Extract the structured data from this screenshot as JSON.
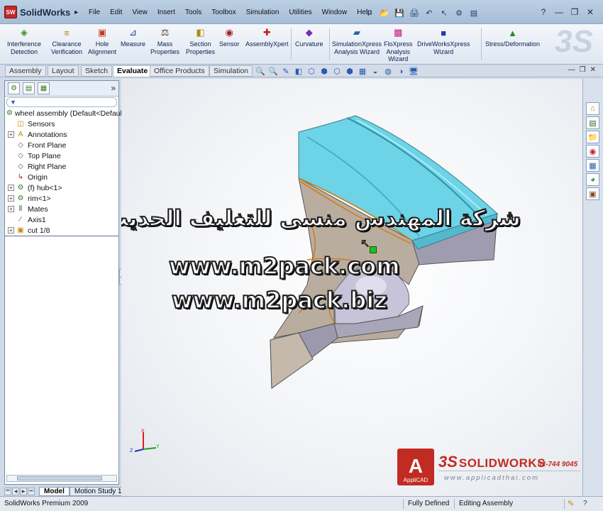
{
  "app": {
    "logo_badge": "SW",
    "logo_text": "SolidWorks",
    "logo_arrow": "►"
  },
  "menu": [
    "File",
    "Edit",
    "View",
    "Insert",
    "Tools",
    "Toolbox",
    "Simulation",
    "Utilities",
    "Window",
    "Help"
  ],
  "menu_pin": "⊳",
  "quick_access": [
    "□",
    "📂",
    "💾",
    "🖨",
    "↶",
    "↖",
    "⚙",
    "▤"
  ],
  "window_controls": {
    "help": "?",
    "minimize": "—",
    "restore": "❐",
    "close": "✕"
  },
  "command_manager": {
    "tools": [
      {
        "id": "interference-detection",
        "label1": "Interference",
        "label2": "Detection",
        "icon": "◈",
        "color": "#4a8a2a"
      },
      {
        "id": "clearance-verification",
        "label1": "Clearance",
        "label2": "Verification",
        "icon": "≡",
        "color": "#b08a10"
      },
      {
        "id": "hole-alignment",
        "label1": "Hole",
        "label2": "Alignment",
        "icon": "▣",
        "color": "#c23a20"
      },
      {
        "id": "measure",
        "label1": "Measure",
        "label2": "",
        "icon": "⊿",
        "color": "#1c4a90"
      },
      {
        "id": "mass-properties",
        "label1": "Mass",
        "label2": "Properties",
        "icon": "⚖",
        "color": "#5a3a10"
      },
      {
        "id": "section-properties",
        "label1": "Section",
        "label2": "Properties",
        "icon": "◧",
        "color": "#b08a10"
      },
      {
        "id": "sensor",
        "label1": "Sensor",
        "label2": "",
        "icon": "◉",
        "color": "#a02020"
      },
      {
        "id": "assemblyxpert",
        "label1": "AssemblyXpert",
        "label2": "",
        "icon": "✚",
        "color": "#c02020"
      },
      {
        "id": "curvature",
        "label1": "Curvature",
        "label2": "",
        "icon": "◆",
        "color": "#7a2ab0"
      },
      {
        "id": "simulationxpress",
        "label1": "SimulationXpress",
        "label2": "Analysis Wizard",
        "icon": "▰",
        "color": "#2a60b0"
      },
      {
        "id": "floxpress",
        "label1": "FloXpress",
        "label2": "Analysis",
        "label3": "Wizard",
        "icon": "▩",
        "color": "#c02080"
      },
      {
        "id": "driveworksxpress",
        "label1": "DriveWorksXpress",
        "label2": "Wizard",
        "icon": "■",
        "color": "#2a3ab0"
      },
      {
        "id": "stress-deformation",
        "label1": "Stress/Deformation",
        "label2": "",
        "icon": "▲",
        "color": "#2a8a2a"
      }
    ],
    "watermark": "3S"
  },
  "tabs": [
    "Assembly",
    "Layout",
    "Sketch",
    "Evaluate",
    "Office Products",
    "Simulation"
  ],
  "active_tab": "Evaluate",
  "view_toolbar": [
    "🔍",
    "🔍",
    "✎",
    "◧",
    "⬡",
    "⬢",
    "⬡",
    "⬢",
    "▦",
    "◒",
    "◍",
    "◑",
    "🖥"
  ],
  "doc_controls": {
    "minimize": "—",
    "restore": "❐",
    "close": "✕"
  },
  "feature_tree": {
    "filter_icon": "▼",
    "collapse": "»",
    "panel_tabs": [
      "⚙",
      "▤",
      "▦"
    ],
    "root": "wheel assembly  (Default<Default",
    "items": [
      {
        "label": "Sensors",
        "expander": "",
        "icon": "◫"
      },
      {
        "label": "Annotations",
        "expander": "+",
        "icon": "A"
      },
      {
        "label": "Front Plane",
        "expander": "",
        "icon": "◇"
      },
      {
        "label": "Top Plane",
        "expander": "",
        "icon": "◇"
      },
      {
        "label": "Right Plane",
        "expander": "",
        "icon": "◇"
      },
      {
        "label": "Origin",
        "expander": "",
        "icon": "↳"
      },
      {
        "label": "(f) hub<1>",
        "expander": "+",
        "icon": "⚙"
      },
      {
        "label": "rim<1>",
        "expander": "+",
        "icon": "⚙"
      },
      {
        "label": "Mates",
        "expander": "+",
        "icon": "⫴"
      },
      {
        "label": "Axis1",
        "expander": "",
        "icon": "∕"
      },
      {
        "label": "cut 1/8",
        "expander": "+",
        "icon": "▣"
      }
    ]
  },
  "bottom_tabs": [
    "Model",
    "Motion Study 1"
  ],
  "status": {
    "app": "SolidWorks Premium 2009",
    "definition": "Fully Defined",
    "mode": "Editing Assembly",
    "help": "?"
  },
  "task_pane": [
    "⌂",
    "▤",
    "📁",
    "◉",
    "▦",
    "◕",
    "▣"
  ],
  "watermark": {
    "arabic": "شركة المهندس منسى للتغليف الحديث",
    "url1": "www.m2pack.com",
    "url2": "www.m2pack.biz"
  },
  "triad": {
    "x": "X",
    "y": "Y",
    "z": "Z"
  },
  "branding": {
    "applicad_letter": "A",
    "applicad_name": "AppliCAD",
    "ds": "3S",
    "solidworks": "SOLIDWORKS",
    "phone": "02-744 9045",
    "url": "www.applicadthai.com"
  },
  "colors": {
    "model_top": "#6dd3e6",
    "model_side": "#9c9aa6",
    "model_face": "#b6a99a",
    "edge": "#d07a10",
    "accent": "#c22b22"
  }
}
